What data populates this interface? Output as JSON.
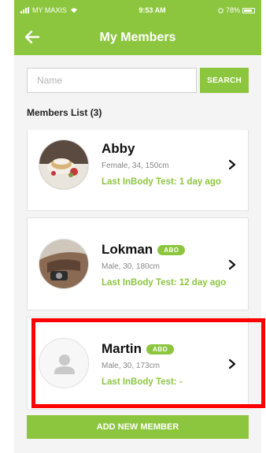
{
  "status_bar": {
    "carrier": "MY MAXIS",
    "time": "9:53 AM",
    "battery": "78%"
  },
  "header": {
    "title": "My Members"
  },
  "search": {
    "placeholder": "Name",
    "button_label": "SEARCH"
  },
  "members_list": {
    "title": "Members List (3)",
    "members": [
      {
        "name": "Abby",
        "badge": "",
        "details": "Female, 34, 150cm",
        "last_test": "Last InBody Test: 1 day ago",
        "avatar": "photo-food-icon"
      },
      {
        "name": "Lokman",
        "badge": "ABO",
        "details": "Male, 30, 180cm",
        "last_test": "Last InBody Test: 12 day ago",
        "avatar": "photo-car-interior-icon"
      },
      {
        "name": "Martin",
        "badge": "ABO",
        "details": "Male, 30, 173cm",
        "last_test": "Last InBody Test: -",
        "avatar": "default-person-icon"
      }
    ]
  },
  "add_button_label": "ADD NEW MEMBER",
  "colors": {
    "accent": "#8cc63f",
    "highlight": "#ff0000"
  }
}
